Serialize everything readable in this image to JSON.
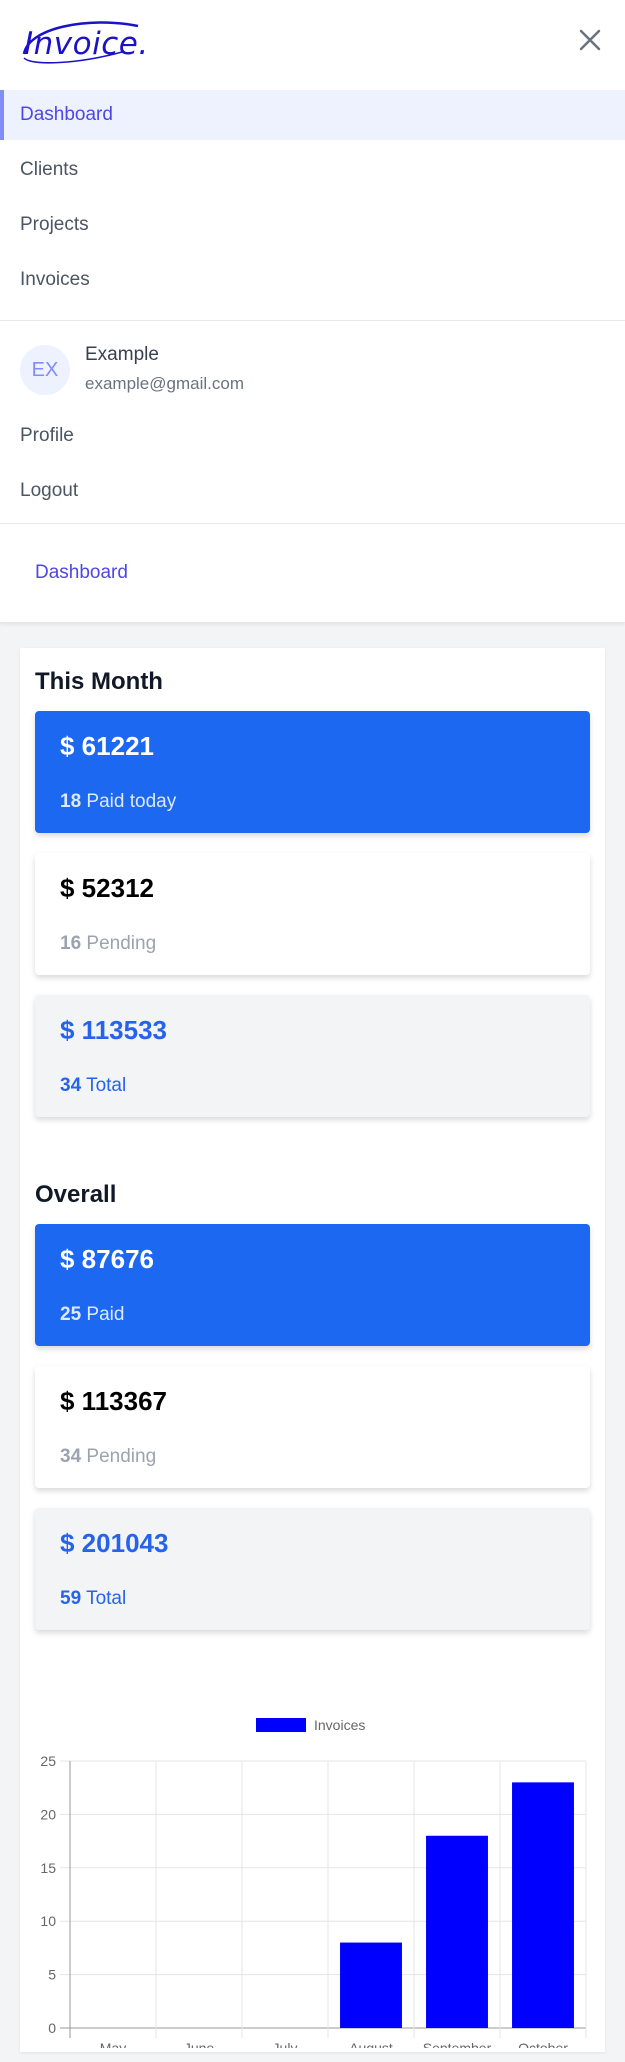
{
  "app": {
    "logo_text": "Invoice.",
    "brand_color": "#1a12c9",
    "close_icon": "close-icon"
  },
  "nav": {
    "items": [
      {
        "label": "Dashboard",
        "active": true
      },
      {
        "label": "Clients",
        "active": false
      },
      {
        "label": "Projects",
        "active": false
      },
      {
        "label": "Invoices",
        "active": false
      }
    ]
  },
  "user": {
    "initials": "EX",
    "name": "Example",
    "email": "example@gmail.com",
    "menu": [
      {
        "label": "Profile"
      },
      {
        "label": "Logout"
      }
    ]
  },
  "breadcrumb": {
    "label": "Dashboard"
  },
  "this_month": {
    "title": "This Month",
    "cards": [
      {
        "amount": "$ 61221",
        "count": "18",
        "label": "Paid today",
        "style": "blue"
      },
      {
        "amount": "$ 52312",
        "count": "16",
        "label": "Pending",
        "style": "white"
      },
      {
        "amount": "$ 113533",
        "count": "34",
        "label": "Total",
        "style": "gray"
      }
    ]
  },
  "overall": {
    "title": "Overall",
    "cards": [
      {
        "amount": "$ 87676",
        "count": "25",
        "label": "Paid",
        "style": "blue"
      },
      {
        "amount": "$ 113367",
        "count": "34",
        "label": "Pending",
        "style": "white"
      },
      {
        "amount": "$ 201043",
        "count": "59",
        "label": "Total",
        "style": "gray"
      }
    ]
  },
  "colors": {
    "accent": "#4f46e5",
    "card_blue": "#1d68f0",
    "bar": "#0000ff"
  },
  "chart_data": {
    "type": "bar",
    "categories": [
      "May",
      "June",
      "July",
      "August",
      "September",
      "October"
    ],
    "series": [
      {
        "name": "Invoices",
        "values": [
          0,
          0,
          0,
          8,
          18,
          23
        ],
        "color": "#0000ff"
      }
    ],
    "ylim": [
      0,
      25
    ],
    "yticks": [
      0,
      5,
      10,
      15,
      20,
      25
    ],
    "grid": true,
    "legend_position": "top"
  }
}
